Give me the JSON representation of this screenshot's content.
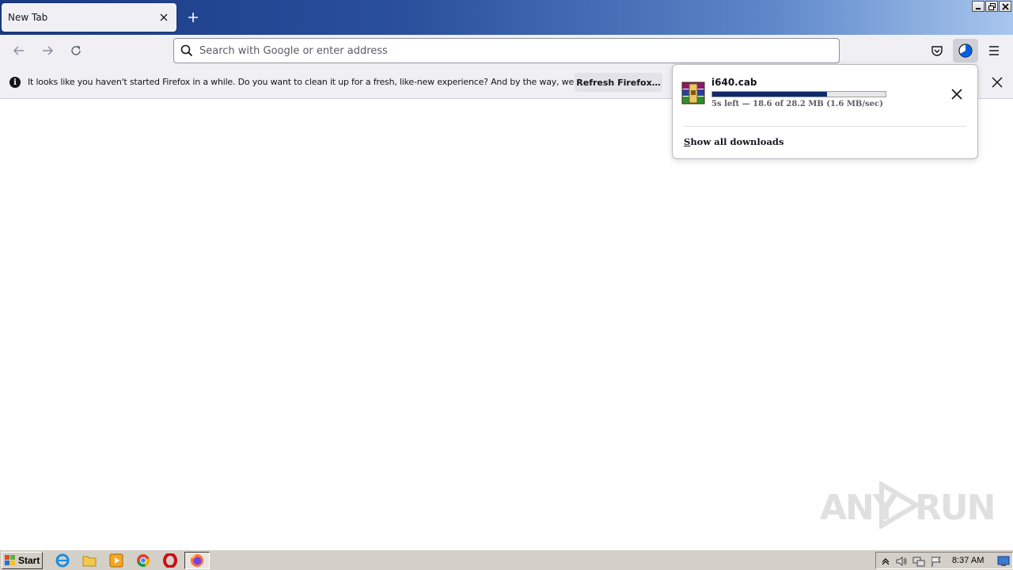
{
  "browser": {
    "tab": {
      "title": "New Tab"
    },
    "urlbar": {
      "placeholder": "Search with Google or enter address",
      "value": ""
    }
  },
  "notification": {
    "message": "It looks like you haven't started Firefox in a while. Do you want to clean it up for a fresh, like-new experience? And by the way, welcome back!",
    "button_label": "Refresh Firefox…"
  },
  "downloads": {
    "items": [
      {
        "filename": "i640.cab",
        "progress": 0.66,
        "status": "5s left — 18.6 of 28.2 MB (1.6 MB/sec)"
      }
    ],
    "show_all": {
      "first_letter": "S",
      "rest": "how all downloads"
    }
  },
  "watermark": {
    "left": "ANY",
    "right": "RUN"
  },
  "taskbar": {
    "start_label": "Start",
    "clock": "8:37 AM",
    "apps": [
      "internet-explorer-icon",
      "folder-icon",
      "media-player-icon",
      "chrome-icon",
      "opera-icon",
      "firefox-icon"
    ]
  },
  "colors": {
    "accent": "#0f2a6a",
    "toolbar": "#f0f0f4"
  }
}
